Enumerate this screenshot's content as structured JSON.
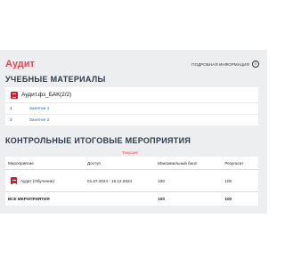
{
  "header": {
    "title": "Аудит",
    "detail_link": "ПОДРОБНАЯ ИНФОРМАЦИЯ",
    "info_icon": "i"
  },
  "materials": {
    "section_title": "УЧЕБНЫЕ МАТЕРИАЛЫ",
    "card_icon": "document-icon",
    "card_name": "Аудит.фз_БАК(2/2)",
    "lessons": [
      {
        "num": "1",
        "label": "Занятие 1"
      },
      {
        "num": "2",
        "label": "Занятие 2"
      }
    ]
  },
  "events": {
    "section_title": "КОНТРОЛЬНЫЕ ИТОГОВЫЕ МЕРОПРИЯТИЯ",
    "tab_current": "Текущие",
    "columns": [
      "Мероприятие",
      "Доступ",
      "Максимальный балл",
      "Результат"
    ],
    "rows": [
      {
        "name": "Аудит (Обучение)",
        "access": "01.07.2024 - 16.12.2024",
        "max_score": "100",
        "result": "100"
      }
    ],
    "total": {
      "label": "ВСЕ МЕРОПРИЯТИЯ",
      "max_score": "100",
      "result": "100"
    }
  },
  "colors": {
    "accent": "#e5484d",
    "icon_red": "#c0262c",
    "link": "#2a63b5",
    "background": "#eceef0"
  }
}
